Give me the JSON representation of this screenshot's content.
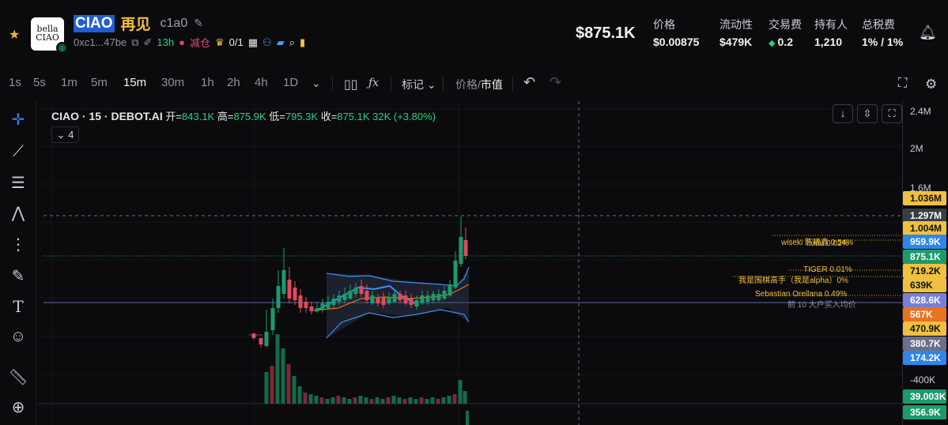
{
  "header": {
    "logo_text": "bella\nCIAO",
    "symbol": "CIAO",
    "name_cn": "再见",
    "handle": "c1a0",
    "address": "0xc1...47be",
    "age": "13h",
    "tag_reduce": "减仓",
    "crown_count": "0/1",
    "market_cap": "$875.1K",
    "stats": [
      {
        "label": "价格",
        "value": "$0.00875"
      },
      {
        "label": "流动性",
        "value": "$479K"
      },
      {
        "label": "交易费",
        "value": "0.2"
      },
      {
        "label": "持有人",
        "value": "1,210"
      },
      {
        "label": "总税费",
        "value": "1% / 1%"
      }
    ],
    "icons": [
      "star-icon",
      "edit-icon",
      "copy-icon",
      "pen-icon",
      "crown-icon",
      "bell-icon"
    ]
  },
  "toolbar": {
    "timeframes": [
      "1s",
      "5s",
      "1m",
      "5m",
      "15m",
      "30m",
      "1h",
      "2h",
      "4h",
      "1D"
    ],
    "active_timeframe": "15m",
    "mark_label": "标记",
    "price_label": "价格",
    "mcap_label": "市值"
  },
  "chart": {
    "legend_title": "CIAO · 15 · DEBOT.AI",
    "open_label": "开=",
    "open": "843.1K",
    "high_label": "高=",
    "high": "875.9K",
    "low_label": "低=",
    "low": "795.3K",
    "close_label": "收=",
    "close": "875.1K",
    "volume": "32K",
    "change": "(+3.80%)",
    "indicator_count": "4",
    "axis_ticks": [
      "2.4M",
      "2M",
      "1.6M",
      "-400K"
    ],
    "price_pills": [
      {
        "label": "1.036M",
        "bg": "#f0c040",
        "fg": "#111"
      },
      {
        "label": "1.297M",
        "bg": "#3a3c44",
        "fg": "#fff"
      },
      {
        "label": "1.004M",
        "bg": "#f0c040",
        "fg": "#111"
      },
      {
        "label": "959.9K",
        "bg": "#2f86e8",
        "fg": "#fff"
      },
      {
        "label": "875.1K",
        "bg": "#1d9a6c",
        "fg": "#fff"
      },
      {
        "label": "719.2K",
        "bg": "#f0c040",
        "fg": "#111"
      },
      {
        "label": "639K",
        "bg": "#f0c040",
        "fg": "#111"
      },
      {
        "label": "628.6K",
        "bg": "#7a7fd6",
        "fg": "#fff"
      },
      {
        "label": "567K",
        "bg": "#e9731e",
        "fg": "#fff"
      },
      {
        "label": "470.9K",
        "bg": "#f0c040",
        "fg": "#111"
      },
      {
        "label": "380.7K",
        "bg": "#6b6f8a",
        "fg": "#fff"
      },
      {
        "label": "174.2K",
        "bg": "#2f86e8",
        "fg": "#fff"
      },
      {
        "label": "39.003K",
        "bg": "#1d9a6c",
        "fg": "#fff"
      },
      {
        "label": "356.9K",
        "bg": "#1d9a6c",
        "fg": "#fff"
      }
    ],
    "annotations": [
      {
        "text": "wiseki 陈曦鑫 0.54%",
        "color": "#f0c040"
      },
      {
        "text": "hunu 0.02%",
        "color": "#f0c040"
      },
      {
        "text": "TIGER 0.01%",
        "color": "#f0c040"
      },
      {
        "text": "我是围棋高手（我是alpha）0%",
        "color": "#f0c040"
      },
      {
        "text": "Sebastian Orellana 0.49%",
        "color": "#f0c040"
      },
      {
        "text": "前 10 大户买入均价",
        "color": "#8a8fa0"
      }
    ]
  }
}
